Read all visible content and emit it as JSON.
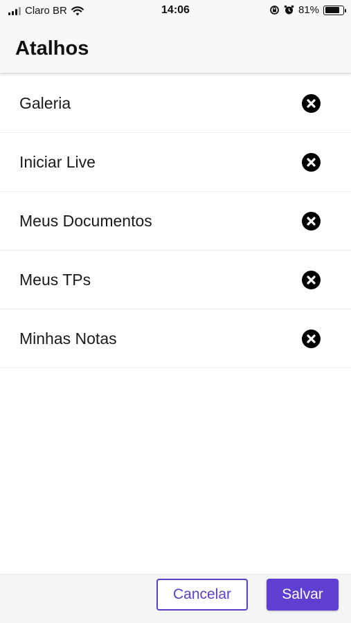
{
  "status_bar": {
    "carrier": "Claro BR",
    "time": "14:06",
    "battery_percent": "81%",
    "battery_level": 0.81,
    "icons": [
      "signal-icon",
      "wifi-icon",
      "rotation-lock-icon",
      "alarm-icon",
      "battery-icon"
    ]
  },
  "header": {
    "title": "Atalhos"
  },
  "shortcuts": {
    "items": [
      {
        "label": "Galeria",
        "action_icon": "remove-circle-icon"
      },
      {
        "label": "Iniciar Live",
        "action_icon": "remove-circle-icon"
      },
      {
        "label": "Meus Documentos",
        "action_icon": "remove-circle-icon"
      },
      {
        "label": "Meus TPs",
        "action_icon": "remove-circle-icon"
      },
      {
        "label": "Minhas Notas",
        "action_icon": "remove-circle-icon"
      }
    ]
  },
  "footer": {
    "cancel_label": "Cancelar",
    "save_label": "Salvar"
  },
  "colors": {
    "accent": "#5e3fd2",
    "header_bg": "#f7f8f9",
    "remove_icon": "#000000"
  }
}
